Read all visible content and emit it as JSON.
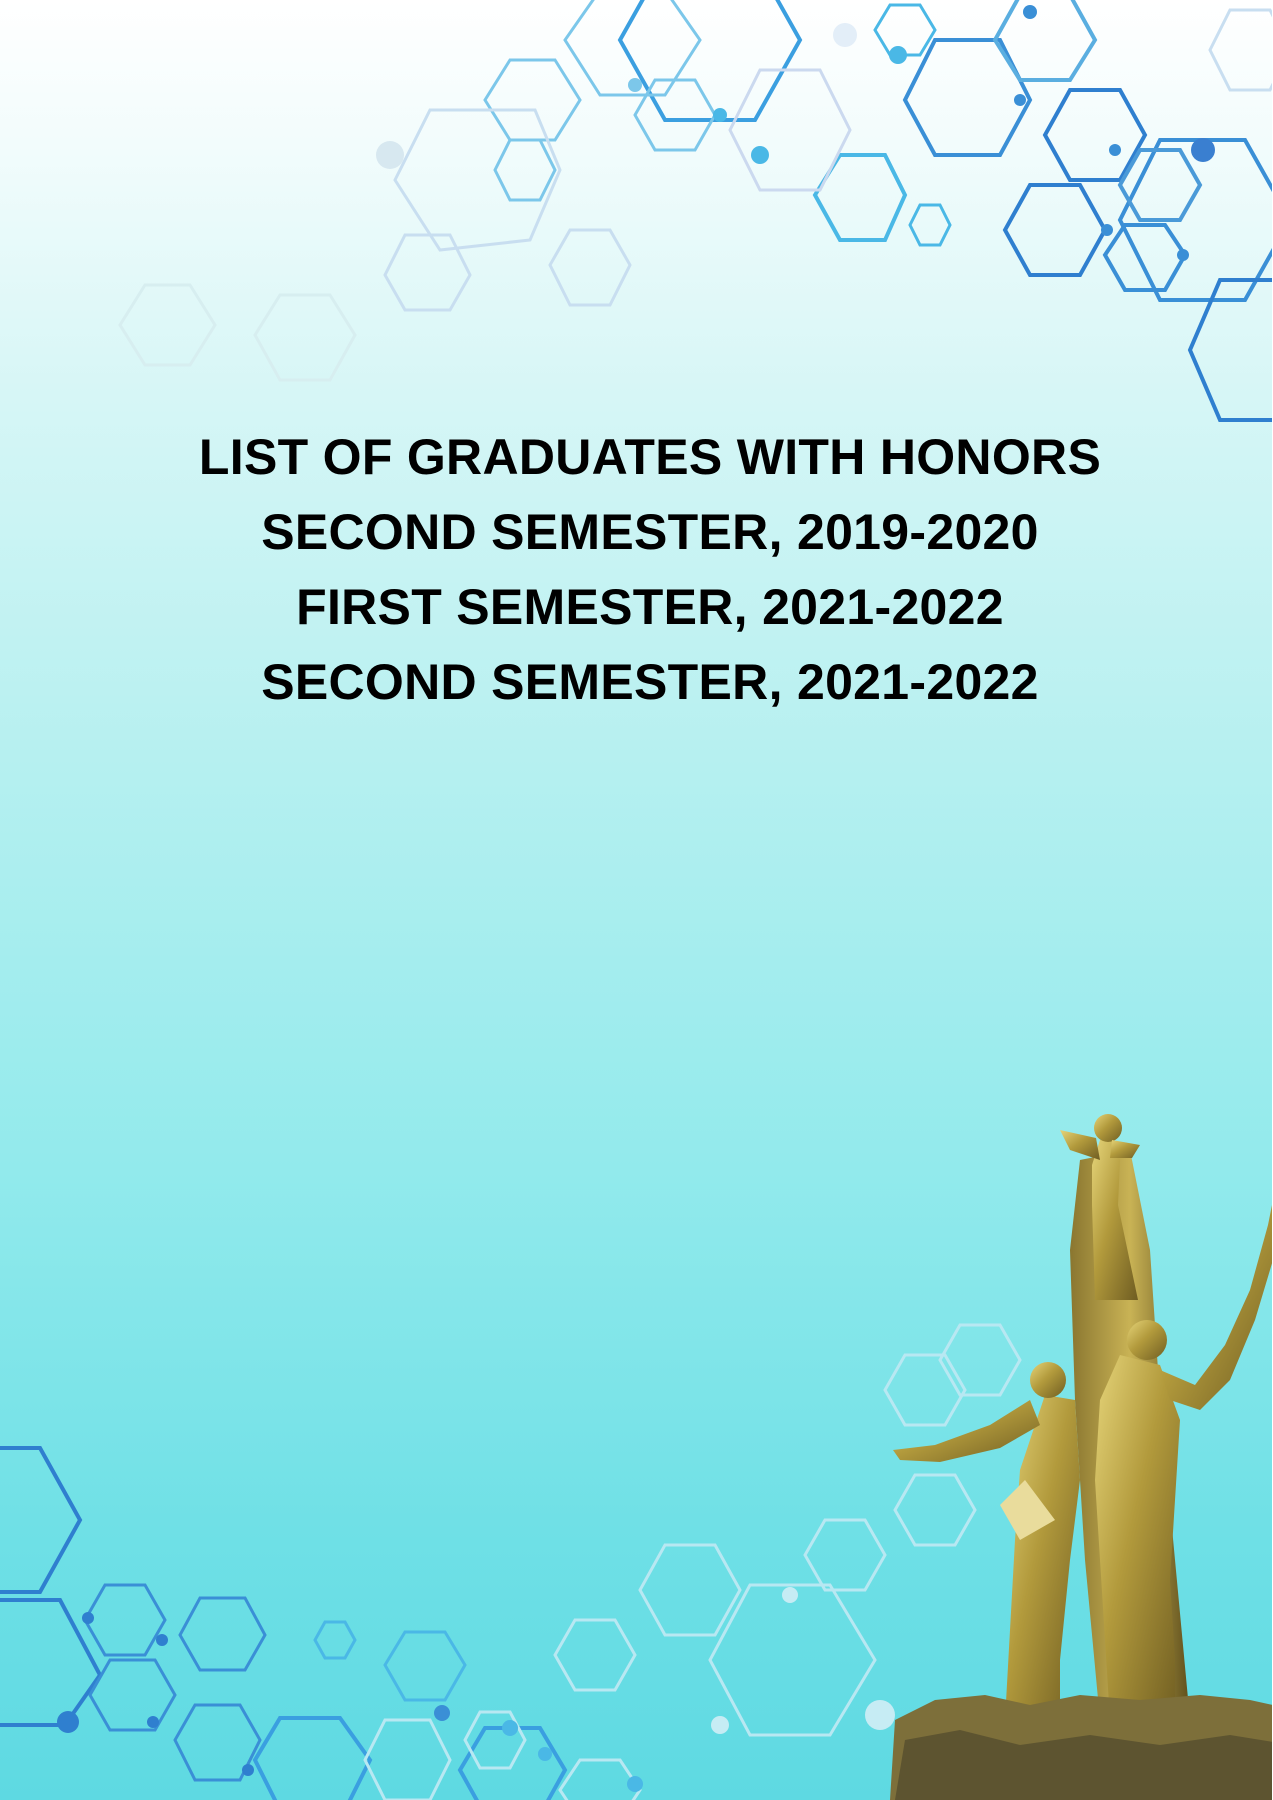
{
  "document": {
    "title_lines": [
      "LIST OF GRADUATES WITH HONORS",
      "SECOND SEMESTER, 2019-2020",
      "FIRST SEMESTER, 2021-2022",
      "SECOND SEMESTER, 2021-2022"
    ]
  },
  "decor": {
    "pattern": "hexagon-network",
    "monument": "golden-statue",
    "colors": {
      "hex_dark": "#3a8fd6",
      "hex_mid": "#4ab8e6",
      "hex_light": "#b9d9ef",
      "statue_gold": "#b29a3c"
    }
  }
}
